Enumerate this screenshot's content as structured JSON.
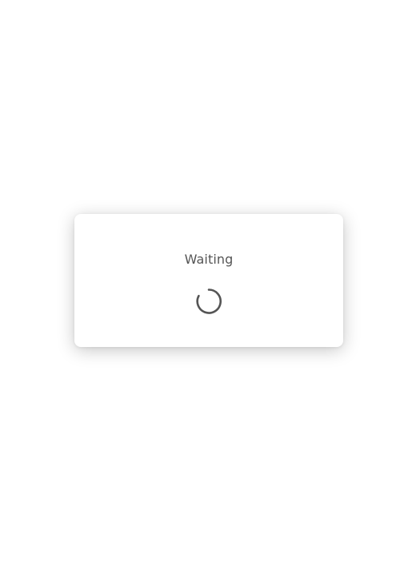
{
  "dialog": {
    "title": "Waiting",
    "spinner_icon": "loading-spinner-icon"
  },
  "colors": {
    "background": "#ffffff",
    "text": "#555555",
    "spinner": "#555555"
  }
}
